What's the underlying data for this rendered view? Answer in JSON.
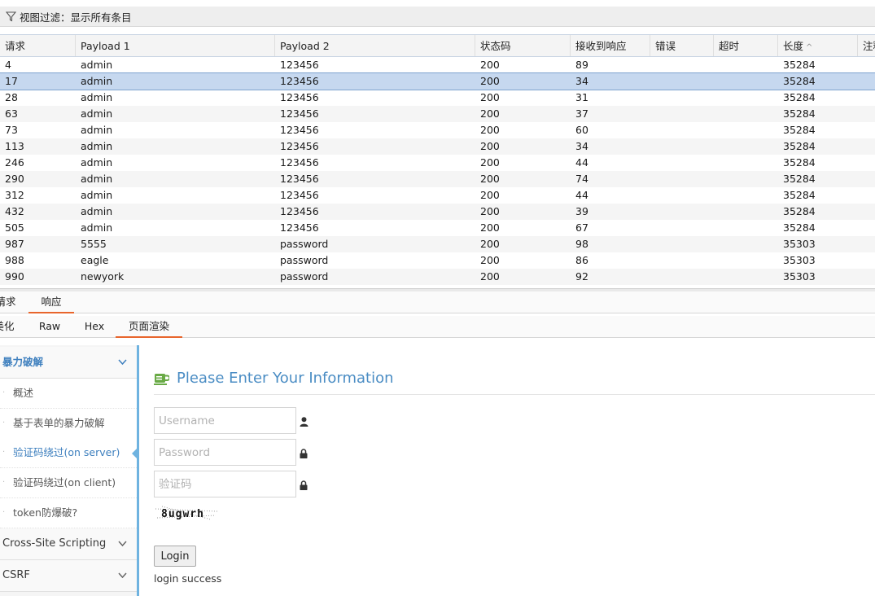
{
  "filter": {
    "text": "视图过滤：显示所有条目"
  },
  "table": {
    "columns": [
      "请求",
      "Payload 1",
      "Payload 2",
      "状态码",
      "接收到响应",
      "错误",
      "超时",
      "长度",
      "注释"
    ],
    "rows": [
      [
        "4",
        "admin",
        "123456",
        "200",
        "89",
        "",
        "",
        "35284"
      ],
      [
        "17",
        "admin",
        "123456",
        "200",
        "34",
        "",
        "",
        "35284"
      ],
      [
        "28",
        "admin",
        "123456",
        "200",
        "31",
        "",
        "",
        "35284"
      ],
      [
        "63",
        "admin",
        "123456",
        "200",
        "37",
        "",
        "",
        "35284"
      ],
      [
        "73",
        "admin",
        "123456",
        "200",
        "60",
        "",
        "",
        "35284"
      ],
      [
        "113",
        "admin",
        "123456",
        "200",
        "34",
        "",
        "",
        "35284"
      ],
      [
        "246",
        "admin",
        "123456",
        "200",
        "44",
        "",
        "",
        "35284"
      ],
      [
        "290",
        "admin",
        "123456",
        "200",
        "74",
        "",
        "",
        "35284"
      ],
      [
        "312",
        "admin",
        "123456",
        "200",
        "44",
        "",
        "",
        "35284"
      ],
      [
        "432",
        "admin",
        "123456",
        "200",
        "39",
        "",
        "",
        "35284"
      ],
      [
        "505",
        "admin",
        "123456",
        "200",
        "67",
        "",
        "",
        "35284"
      ],
      [
        "987",
        "5555",
        "password",
        "200",
        "98",
        "",
        "",
        "35303"
      ],
      [
        "988",
        "eagle",
        "password",
        "200",
        "86",
        "",
        "",
        "35303"
      ],
      [
        "990",
        "newyork",
        "password",
        "200",
        "92",
        "",
        "",
        "35303"
      ]
    ],
    "selected_row": 1
  },
  "tabs_top": {
    "request": "请求",
    "response": "响应"
  },
  "tabs_view": {
    "pretty": "美化",
    "raw": "Raw",
    "hex": "Hex",
    "render": "页面渲染"
  },
  "sidebar": {
    "group_brute": "暴力破解",
    "items": [
      "概述",
      "基于表单的暴力破解",
      "验证码绕过(on server)",
      "验证码绕过(on client)",
      "token防爆破?"
    ],
    "group_xss": "Cross-Site Scripting",
    "group_csrf": "CSRF"
  },
  "form": {
    "title": "Please Enter Your Information",
    "username_placeholder": "Username",
    "password_placeholder": "Password",
    "vcode_placeholder": "验证码",
    "captcha_text": "8ugwrh",
    "login_label": "Login",
    "message": "login success"
  },
  "colors": {
    "accent_tab": "#e8652c",
    "sidebar_accent": "#6fb3e0",
    "title_blue": "#4b8dc4",
    "selected_row": "#c6d8ef"
  }
}
